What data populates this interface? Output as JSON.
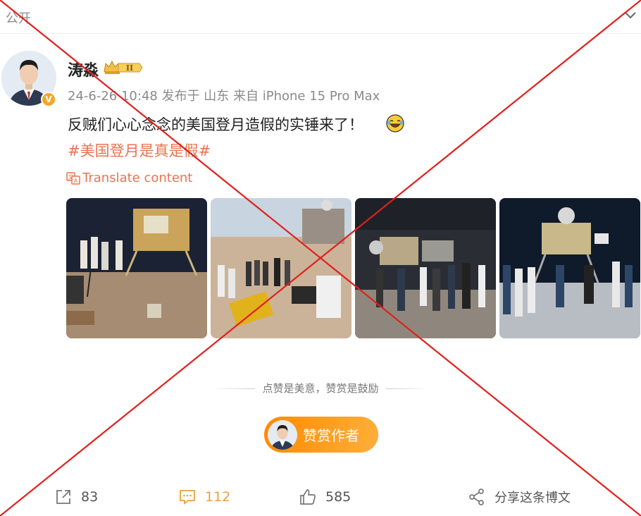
{
  "header": {
    "visibility": "公开",
    "chevron_icon": "chevron-down-icon"
  },
  "author": {
    "name": "涛淼",
    "level_badge": "II",
    "verified_badge": "V",
    "meta": "24-6-26 10:48 发布于 山东 来自 iPhone 15 Pro Max"
  },
  "post": {
    "text": "反贼们心心念念的美国登月造假的实锤来了！",
    "emoji_icon": "laughing-tears-emoji",
    "hashtag": "#美国登月是真是假#",
    "translate_label": "Translate content"
  },
  "images": [
    {
      "name": "photo-moon-set-1"
    },
    {
      "name": "photo-moon-set-2"
    },
    {
      "name": "photo-moon-set-3"
    },
    {
      "name": "photo-moon-set-4"
    }
  ],
  "reward": {
    "hint": "点赞是美意，赞赏是鼓励",
    "button_label": "赞赏作者"
  },
  "actions": {
    "repost_count": "83",
    "comment_count": "112",
    "like_count": "585",
    "share_label": "分享这条博文"
  },
  "colors": {
    "accent": "#eb7350",
    "reward_start": "#ff8a00",
    "reward_end": "#ffae3a",
    "comment_active": "#e8a23b",
    "cross": "#e0201c"
  }
}
